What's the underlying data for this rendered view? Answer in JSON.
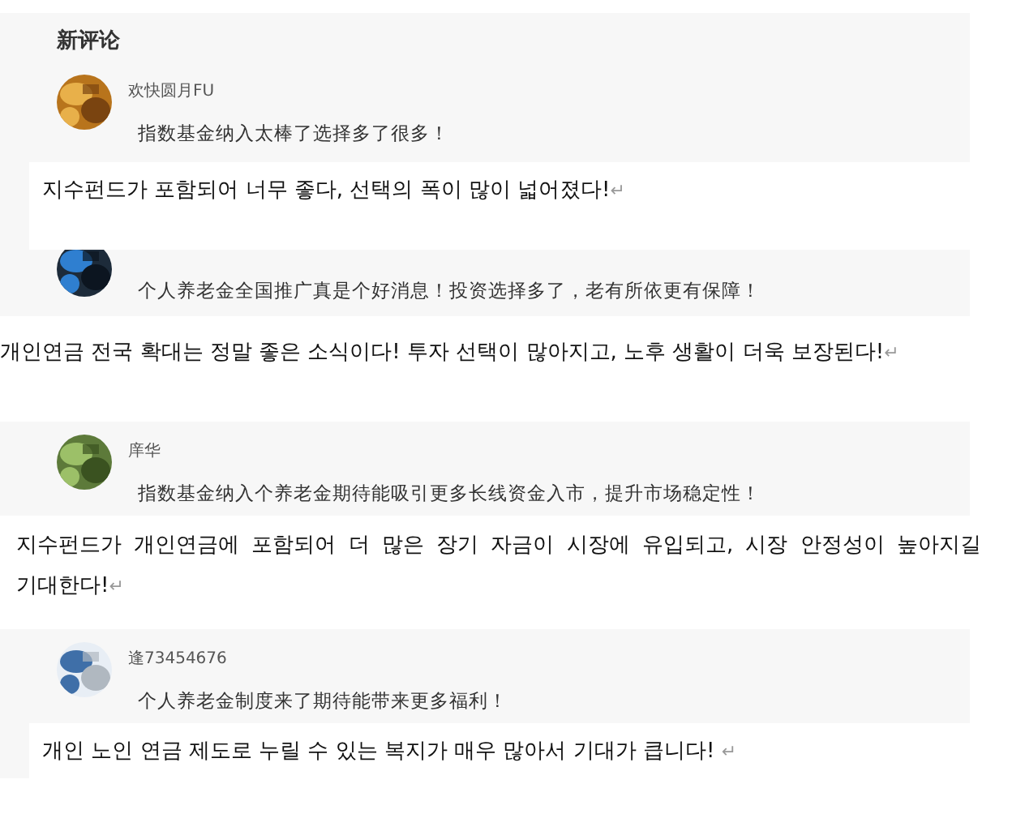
{
  "heading": "新评论",
  "sections": [
    {
      "kind": "screenshot",
      "items": [
        {
          "kind": "comment",
          "author": "欢快圆月FU",
          "text": "指数基金纳入太棒了选择多了很多！"
        },
        {
          "kind": "overlay_note",
          "text": "지수펀드가 포함되어 너무 좋다, 선택의 폭이 많이 넓어졌다!",
          "mark": "↵"
        },
        {
          "kind": "comment",
          "text": "个人养老金全国推广真是个好消息！投资选择多了，老有所依更有保障！"
        }
      ]
    },
    {
      "kind": "note",
      "text": "개인연금 전국 확대는 정말 좋은 소식이다! 투자 선택이 많아지고, 노후 생활이 더욱 보장된다!",
      "mark": "↵"
    },
    {
      "kind": "screenshot",
      "items": [
        {
          "kind": "comment",
          "author": "庠华",
          "text": "指数基金纳入个养老金期待能吸引更多长线资金入市，提升市场稳定性！"
        }
      ]
    },
    {
      "kind": "note",
      "text": "지수펀드가 개인연금에 포함되어 더 많은 장기 자금이 시장에 유입되고, 시장 안정성이 높아지길 기대한다!",
      "mark": "↵"
    },
    {
      "kind": "screenshot",
      "items": [
        {
          "kind": "comment",
          "author": "逢73454676",
          "text": "个人养老金制度来了期待能带来更多福利！"
        },
        {
          "kind": "overlay_note",
          "text": "개인 노인 연금 제도로 누릴 수 있는 복지가 매우 많아서 기대가 큽니다! ",
          "mark": "↵"
        }
      ]
    }
  ]
}
